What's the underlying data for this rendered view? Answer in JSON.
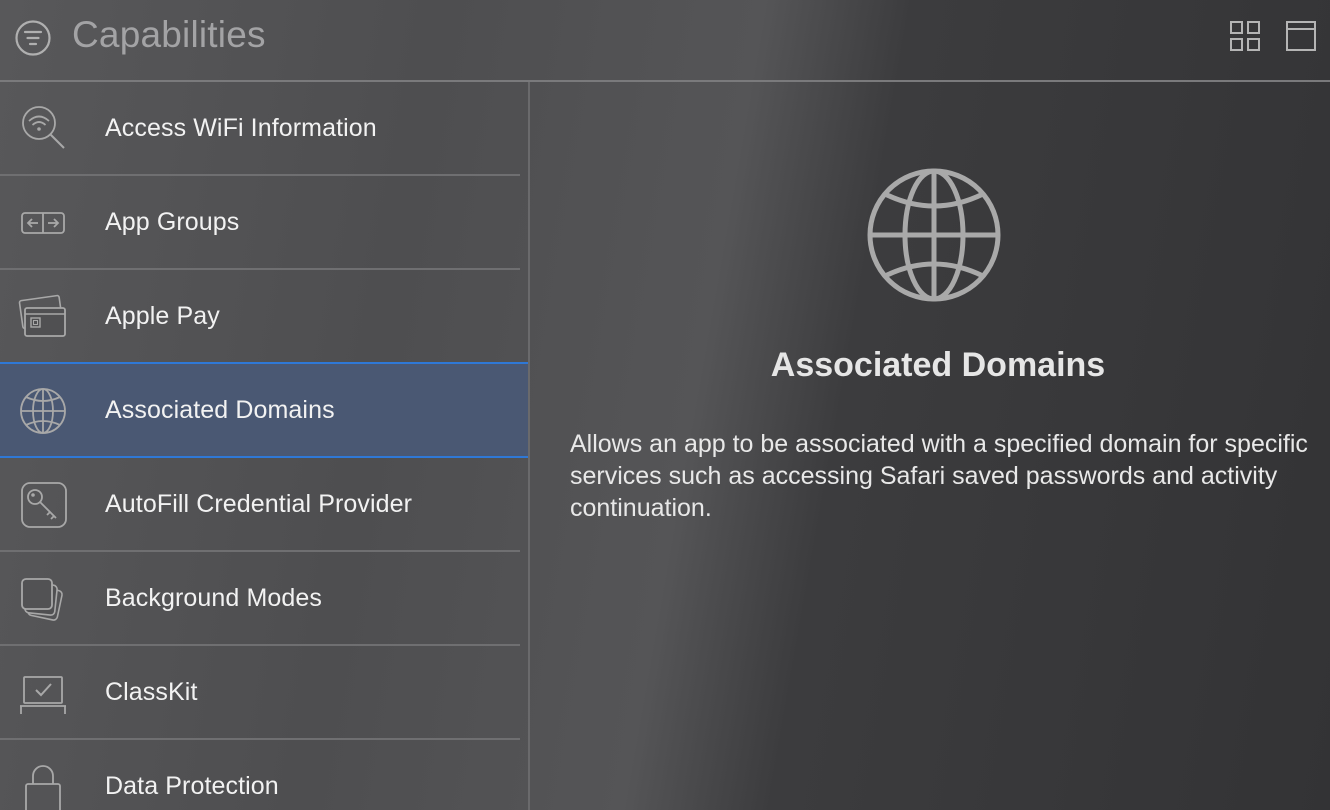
{
  "header": {
    "title": "Capabilities",
    "filter_icon": "filter-icon",
    "view_buttons": [
      "grid-view-icon",
      "single-view-icon"
    ]
  },
  "sidebar": {
    "items": [
      {
        "label": "Access WiFi Information",
        "icon": "wifi-search-icon"
      },
      {
        "label": "App Groups",
        "icon": "app-groups-icon"
      },
      {
        "label": "Apple Pay",
        "icon": "credit-card-icon"
      },
      {
        "label": "Associated Domains",
        "icon": "globe-icon",
        "selected": true
      },
      {
        "label": "AutoFill Credential Provider",
        "icon": "key-icon"
      },
      {
        "label": "Background Modes",
        "icon": "stacked-squares-icon"
      },
      {
        "label": "ClassKit",
        "icon": "classkit-icon"
      },
      {
        "label": "Data Protection",
        "icon": "lock-icon"
      }
    ]
  },
  "detail": {
    "icon": "globe-icon",
    "title": "Associated Domains",
    "description": "Allows an app to be associated with a specified domain for specific services such as accessing Safari saved passwords and activity continuation."
  },
  "colors": {
    "selection_fill": "#4a5873",
    "selection_border": "#2f78d6",
    "icon_stroke": "#a8a8a8"
  }
}
